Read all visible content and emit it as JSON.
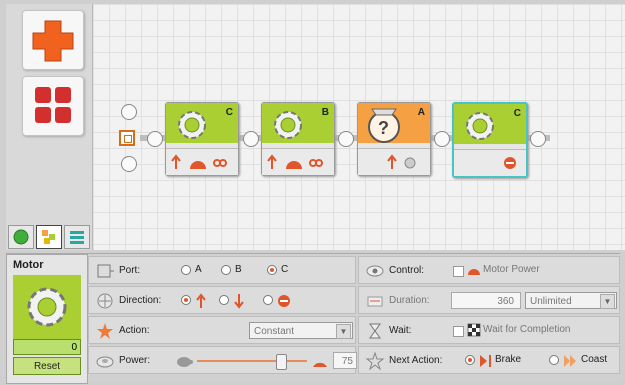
{
  "palette": {
    "buttons": [
      {
        "icon": "plus-icon"
      },
      {
        "icon": "grid-icon"
      }
    ],
    "tabs": [
      {
        "icon": "circle-icon"
      },
      {
        "icon": "blocks-icon"
      },
      {
        "icon": "list-icon"
      }
    ]
  },
  "program": {
    "blocks": [
      {
        "type": "motor",
        "port": "C",
        "icon": "gear-icon"
      },
      {
        "type": "motor",
        "port": "B",
        "icon": "gear-icon"
      },
      {
        "type": "sensor",
        "port": "A",
        "icon": "question-icon"
      },
      {
        "type": "motor",
        "port": "C",
        "icon": "gear-icon",
        "selected": true
      }
    ]
  },
  "config": {
    "title": "Motor",
    "value": "0",
    "reset_label": "Reset",
    "port": {
      "label": "Port:",
      "options": [
        "A",
        "B",
        "C"
      ],
      "selected": "C"
    },
    "direction": {
      "label": "Direction:"
    },
    "action": {
      "label": "Action:",
      "value": "Constant"
    },
    "power": {
      "label": "Power:",
      "value": "75",
      "level_percent": 75
    },
    "control": {
      "label": "Control:",
      "option": "Motor Power"
    },
    "duration": {
      "label": "Duration:",
      "value": "360",
      "unit": "Unlimited"
    },
    "wait": {
      "label": "Wait:",
      "option": "Wait for Completion"
    },
    "next_action": {
      "label": "Next Action:",
      "brake": "Brake",
      "coast": "Coast",
      "selected": "Brake"
    }
  },
  "colors": {
    "motor_green": "#a9cf32",
    "sensor_orange": "#f5a043",
    "accent_red": "#d32f2f",
    "select_cyan": "#48c4c4"
  }
}
